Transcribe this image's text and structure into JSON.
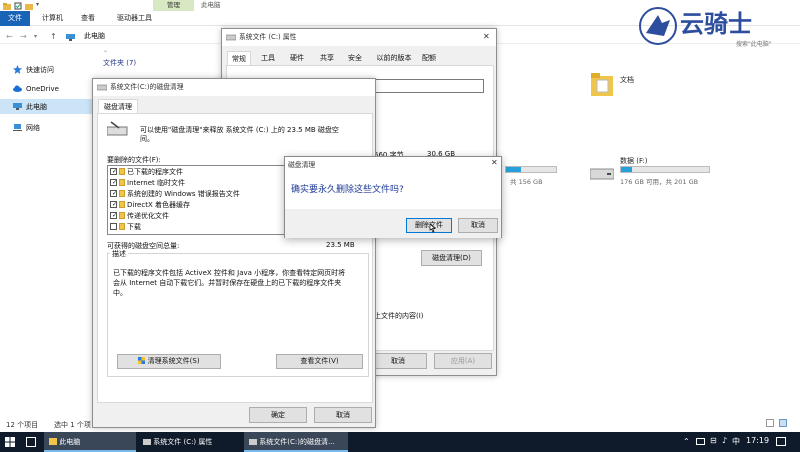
{
  "explorer": {
    "title_manage": "管理",
    "title": "此电脑",
    "ribbon_tabs": [
      "文件",
      "计算机",
      "查看",
      "驱动器工具"
    ],
    "address": "此电脑",
    "search_placeholder": "搜索\"此电脑\"",
    "sidebar": [
      {
        "label": "快速访问",
        "icon": "star-icon"
      },
      {
        "label": "OneDrive",
        "icon": "cloud-icon"
      },
      {
        "label": "此电脑",
        "icon": "computer-icon"
      },
      {
        "label": "网络",
        "icon": "network-icon"
      }
    ],
    "folders_header": "文件夹 (7)",
    "folder_docs": "文档",
    "drive_f_name": "数据 (F:)",
    "drive_f_info": "176 GB 可用，共 201 GB",
    "drive_f_fill": 0.125,
    "drive_e_info": "共 156 GB",
    "status_count": "12 个项目",
    "status_selected": "选中 1 个项目"
  },
  "properties": {
    "title": "系统文件 (C:) 属性",
    "tabs": [
      "常规",
      "工具",
      "硬件",
      "共享",
      "安全",
      "以前的版本",
      "配额"
    ],
    "bytes_fragment": "560 字节",
    "size_gb": "30.6 GB",
    "cleanup_button": "磁盘清理(D)",
    "compress_fragment": "上文件的内容(I)",
    "cancel": "取消",
    "apply": "应用(A)"
  },
  "cleanup": {
    "title": "系统文件(C:)的磁盘清理",
    "tab": "磁盘清理",
    "intro": "可以使用\"磁盘清理\"来释放 系统文件 (C:) 上的 23.5 MB 磁盘空间。",
    "files_label": "要删除的文件(F):",
    "items": [
      {
        "label": "已下载的程序文件",
        "checked": true
      },
      {
        "label": "Internet 临时文件",
        "checked": true
      },
      {
        "label": "系统创建的 Windows 错误报告文件",
        "checked": true
      },
      {
        "label": "DirectX 着色器缓存",
        "checked": true
      },
      {
        "label": "传递优化文件",
        "checked": true
      },
      {
        "label": "下载",
        "checked": false
      }
    ],
    "total_label": "可获得的磁盘空间总量:",
    "total_value": "23.5 MB",
    "desc_label": "描述",
    "desc_text": "已下载的程序文件包括 ActiveX 控件和 Java 小程序，你查看特定网页时将会从 Internet 自动下载它们。并暂时保存在硬盘上的已下载的程序文件夹中。",
    "clean_system_button": "清理系统文件(S)",
    "view_files_button": "查看文件(V)",
    "ok": "确定",
    "cancel": "取消"
  },
  "confirm": {
    "title": "磁盘清理",
    "question": "确实要永久删除这些文件吗?",
    "delete_button": "删除文件",
    "cancel_button": "取消"
  },
  "watermark": {
    "text": "云骑士"
  },
  "taskbar": {
    "items": [
      "此电脑",
      "系统文件 (C:) 属性",
      "系统文件(C:)的磁盘清..."
    ],
    "lang": "中",
    "time": "17:19"
  },
  "colors": {
    "accent": "#1a64b8",
    "taskbar": "#0f1a2b",
    "manage_tab": "#d8e8c2",
    "drive_bar": "#26a0da"
  }
}
